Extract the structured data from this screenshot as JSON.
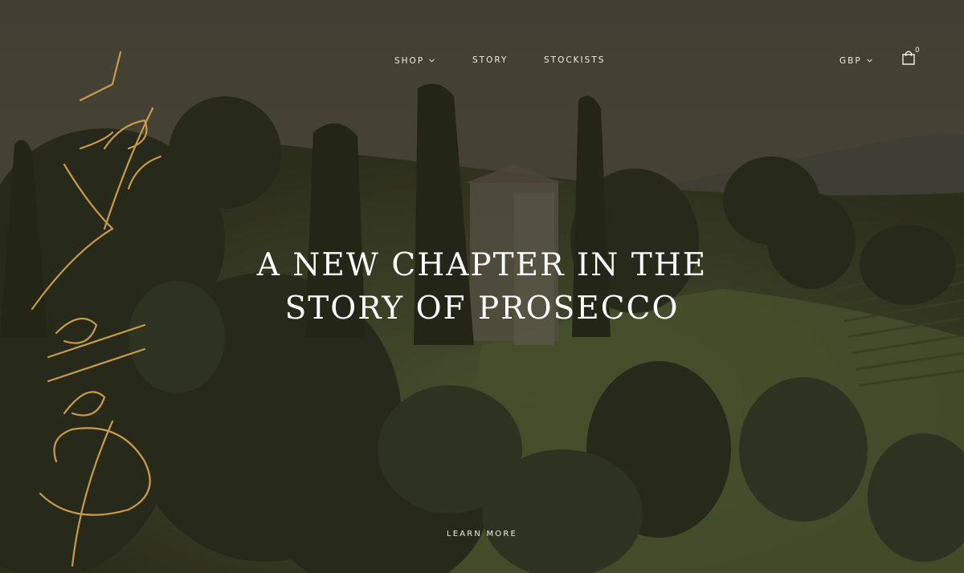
{
  "brand": {
    "logo_text": "Della Vite",
    "logo_color": "#c99a4a"
  },
  "nav": {
    "shop_label": "SHOP",
    "story_label": "STORY",
    "stockists_label": "STOCKISTS",
    "currency_label": "GBP",
    "cart_count": "0",
    "chevron_icon": "chevron-down-icon",
    "cart_icon": "shopping-bag-icon"
  },
  "hero": {
    "headline_line1": "A NEW CHAPTER IN THE",
    "headline_line2": "STORY OF PROSECCO",
    "cta_label": "LEARN MORE",
    "overlay_color": "#3a3429"
  }
}
